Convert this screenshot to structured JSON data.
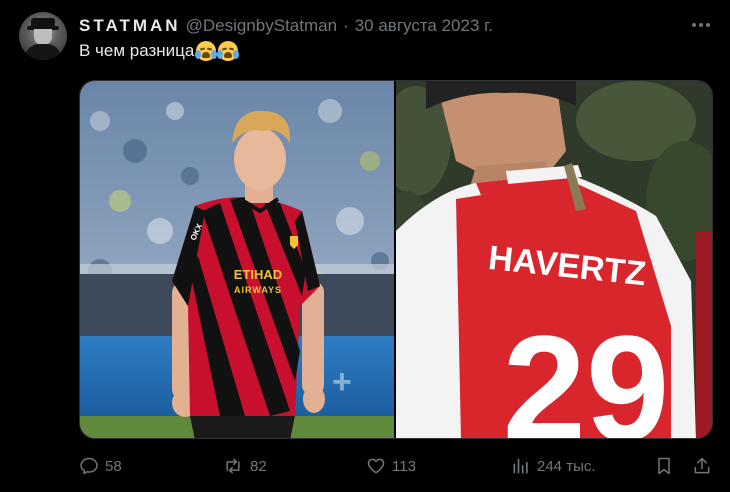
{
  "author": {
    "display_name": "STATMAN",
    "handle": "@DesignbyStatman",
    "separator": "·",
    "date": "30 августа 2023 г."
  },
  "tweet": {
    "text": "В чем разница",
    "emojis": [
      "loudly-crying-face",
      "loudly-crying-face"
    ]
  },
  "media": {
    "left_image": {
      "jersey_sponsor_line1": "ETIHAD",
      "jersey_sponsor_line2": "AIRWAYS",
      "sleeve_sponsor": "OKX",
      "colors": {
        "stripe_red": "#c8102e",
        "stripe_black": "#111111"
      }
    },
    "right_image": {
      "shirt_name": "HAVERTZ",
      "shirt_number": "29",
      "colors": {
        "red": "#d9262c",
        "white": "#f3f3f3"
      }
    }
  },
  "actions": {
    "replies": "58",
    "retweets": "82",
    "likes": "113",
    "views": "244 тыс."
  },
  "colors": {
    "background": "#000000",
    "text_primary": "#e7e9ea",
    "text_secondary": "#71767b"
  }
}
